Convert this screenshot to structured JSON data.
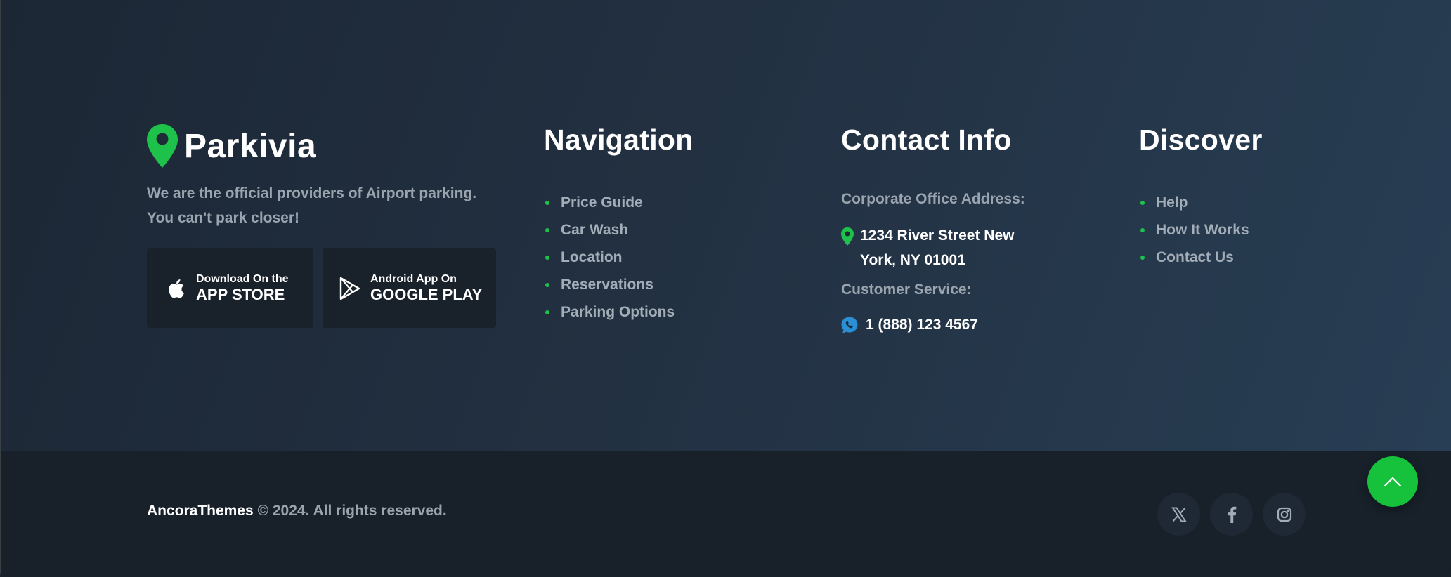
{
  "brand": {
    "name": "Parkivia",
    "tagline_line1": "We are the official providers of Airport parking.",
    "tagline_line2": "You can't park closer!",
    "accent_color": "#1ec14a"
  },
  "apps": {
    "apple": {
      "small": "Download On the",
      "big": "APP STORE",
      "icon": "apple-icon"
    },
    "google": {
      "small": "Android App On",
      "big": "GOOGLE PLAY",
      "icon": "google-play-icon"
    }
  },
  "navigation": {
    "title": "Navigation",
    "items": [
      {
        "label": "Price Guide"
      },
      {
        "label": "Car Wash"
      },
      {
        "label": "Location"
      },
      {
        "label": "Reservations"
      },
      {
        "label": "Parking Options"
      }
    ]
  },
  "contact": {
    "title": "Contact Info",
    "address_label": "Corporate Office Address:",
    "address_line1": "1234 River Street New",
    "address_line2": "York, NY 01001",
    "service_label": "Customer Service:",
    "phone": "1 (888) 123 4567"
  },
  "discover": {
    "title": "Discover",
    "items": [
      {
        "label": "Help"
      },
      {
        "label": "How It Works"
      },
      {
        "label": "Contact Us"
      }
    ]
  },
  "footer": {
    "owner": "AncoraThemes",
    "rights": "© 2024. All rights reserved.",
    "social": [
      "x-icon",
      "facebook-icon",
      "instagram-icon"
    ],
    "scroll_top_icon": "chevron-up-icon",
    "scroll_top_color": "#16c13b"
  }
}
